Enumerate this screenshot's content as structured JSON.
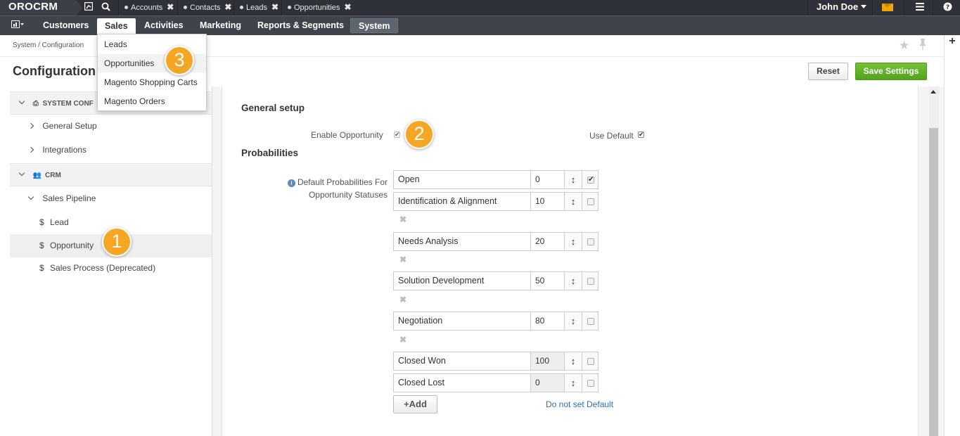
{
  "topbar": {
    "logo": "OROCRM",
    "pinned_tabs": [
      {
        "label": "Accounts"
      },
      {
        "label": "Contacts"
      },
      {
        "label": "Leads"
      },
      {
        "label": "Opportunities"
      }
    ],
    "user_name": "John Doe"
  },
  "nav": {
    "items": [
      "Customers",
      "Sales",
      "Activities",
      "Marketing",
      "Reports & Segments",
      "System"
    ],
    "active": "Sales"
  },
  "dropdown": {
    "items": [
      "Leads",
      "Opportunities",
      "Magento Shopping Carts",
      "Magento Orders"
    ]
  },
  "header": {
    "breadcrumb": "System / Configuration",
    "title": "Configuration",
    "reset_label": "Reset",
    "save_label": "Save Settings"
  },
  "tree": {
    "system_group": "SYSTEM CONF",
    "general_setup": "General Setup",
    "integrations": "Integrations",
    "crm_group": "CRM",
    "sales_pipeline": "Sales Pipeline",
    "lead": "Lead",
    "opportunity": "Opportunity",
    "sales_process": "Sales Process (Deprecated)"
  },
  "content": {
    "general_setup_heading": "General setup",
    "enable_opportunity_label": "Enable Opportunity",
    "enable_opportunity_checked": true,
    "use_default_label": "Use Default",
    "use_default_checked": true,
    "probabilities_heading": "Probabilities",
    "probabilities_label_line1": "Default Probabilities For",
    "probabilities_label_line2": "Opportunity Statuses",
    "statuses": [
      {
        "name": "Open",
        "value": "0",
        "default": true
      },
      {
        "name": "Identification & Alignment",
        "value": "10",
        "default": false
      },
      {
        "name": "Needs Analysis",
        "value": "20",
        "default": false
      },
      {
        "name": "Solution Development",
        "value": "50",
        "default": false
      },
      {
        "name": "Negotiation",
        "value": "80",
        "default": false
      },
      {
        "name": "Closed Won",
        "value": "100",
        "default": false
      },
      {
        "name": "Closed Lost",
        "value": "0",
        "default": false
      }
    ],
    "add_label": "Add",
    "do_not_set_default": "Do not set Default"
  },
  "badges": [
    "1",
    "2",
    "3"
  ],
  "colors": {
    "topbar": "#2e3238",
    "navbar": "#3f444c",
    "save": "#5cb328",
    "badge": "#f5a623",
    "link": "#2a72b5"
  }
}
